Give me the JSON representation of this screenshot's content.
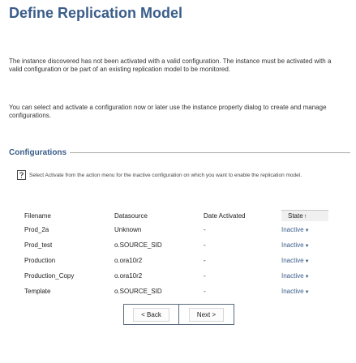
{
  "page": {
    "title": "Define Replication Model",
    "intro_1": "The instance discovered has not been activated with a valid configuration. The instance must be activated with a valid configuration or be part of an existing replication model to be monitored.",
    "intro_2": "You can select and activate a configuration now or later use the instance property dialog to create and manage configurations."
  },
  "configurations": {
    "section_title": "Configurations",
    "hint_icon": "help-question-icon",
    "hint_text": "Select Activate from the action menu for the inactive configuration on which you want to enable the replication model.",
    "columns": {
      "filename": "Filename",
      "datasource": "Datasource",
      "date_activated": "Date Activated",
      "state": "State"
    },
    "sort_indicator": "↑",
    "rows": [
      {
        "filename": "Prod_2a",
        "datasource": "Unknown",
        "date_activated": "-",
        "state": "Inactive"
      },
      {
        "filename": "Prod_test",
        "datasource": "o.SOURCE_SID",
        "date_activated": "-",
        "state": "Inactive"
      },
      {
        "filename": "Production",
        "datasource": "o.ora10r2",
        "date_activated": "-",
        "state": "Inactive"
      },
      {
        "filename": "Production_Copy",
        "datasource": "o.ora10r2",
        "date_activated": "-",
        "state": "Inactive"
      },
      {
        "filename": "Template",
        "datasource": "o.SOURCE_SID",
        "date_activated": "-",
        "state": "Inactive"
      }
    ],
    "dropdown_arrow": "▼"
  },
  "navigation": {
    "back_label": "< Back",
    "next_label": "Next >"
  },
  "colors": {
    "title": "#3a5d8a",
    "state_link": "#3a5d8a",
    "button_border": "#5a6b7f"
  }
}
